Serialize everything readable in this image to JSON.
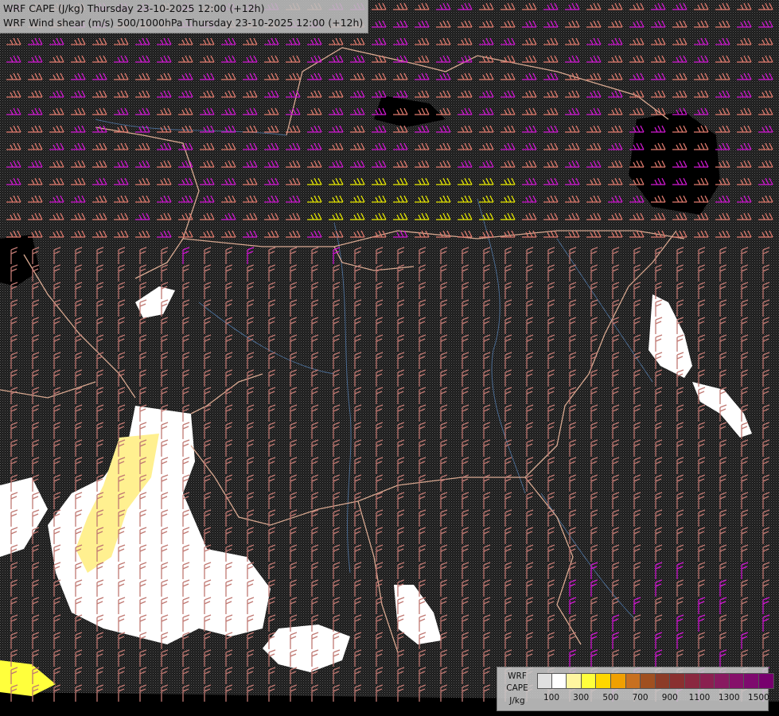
{
  "header": {
    "line1": "WRF CAPE (J/kg) Thursday 23-10-2025 12:00 (+12h)",
    "line2": "WRF Wind shear (m/s) 500/1000hPa Thursday 23-10-2025 12:00 (+12h)"
  },
  "legend": {
    "label_line1": "WRF",
    "label_line2": "CAPE",
    "label_line3": "J/kg",
    "swatch_colors": [
      "#e0e0e0",
      "#ffffff",
      "#fff6a0",
      "#ffff3c",
      "#ffd700",
      "#f0a000",
      "#c87020",
      "#a05020",
      "#8c3c28",
      "#8a3030",
      "#8a2840",
      "#8a2050",
      "#881a60",
      "#86106a",
      "#7e0a6e",
      "#78006e"
    ],
    "ticks": [
      "100",
      "300",
      "500",
      "700",
      "900",
      "1100",
      "1300",
      "1500"
    ]
  },
  "map_colors": {
    "background": "#3a3a3a",
    "shear_low": "#c07872",
    "shear_mid": "#e07a6e",
    "shear_high": "#d018d0",
    "shear_extreme": "#e8e800",
    "border": "#d8a890",
    "river": "#4a6a90",
    "cape_white": "#ffffff",
    "cape_yellow": "#fff090"
  }
}
